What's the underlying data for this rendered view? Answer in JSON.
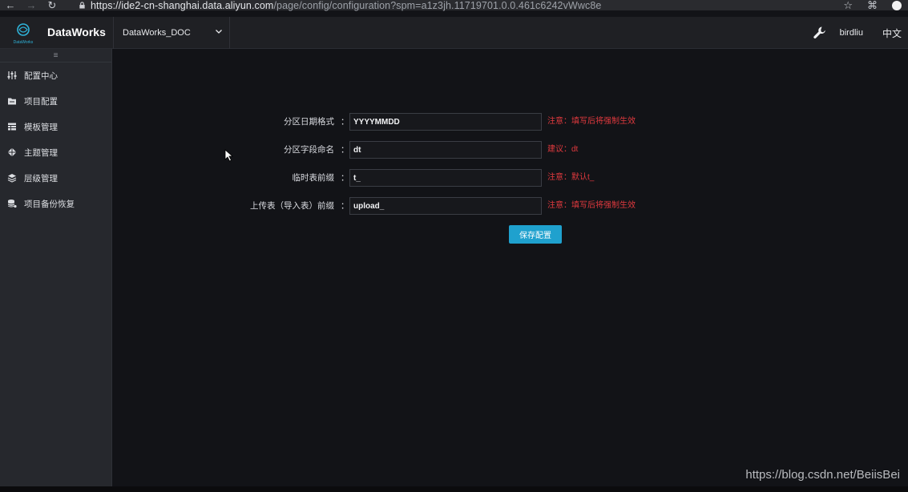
{
  "browser": {
    "url_host": "https://ide2-cn-shanghai.data.aliyun.com",
    "url_path": "/page/config/configuration?spm=a1z3jh.11719701.0.0.461c6242vWwc8e"
  },
  "header": {
    "brand": "DataWorks",
    "logo_text": "DataWorks",
    "project": "DataWorks_DOC",
    "username": "birdliu",
    "language": "中文"
  },
  "sidebar": {
    "collapse_glyph": "≡",
    "items": [
      {
        "label": "配置中心",
        "icon": "sliders-icon"
      },
      {
        "label": "项目配置",
        "icon": "folder-icon"
      },
      {
        "label": "模板管理",
        "icon": "table-icon"
      },
      {
        "label": "主题管理",
        "icon": "theme-icon"
      },
      {
        "label": "层级管理",
        "icon": "layers-icon"
      },
      {
        "label": "项目备份恢复",
        "icon": "database-icon"
      }
    ]
  },
  "form": {
    "rows": [
      {
        "label": "分区日期格式",
        "value": "YYYYMMDD",
        "hint": "注意：填写后将强制生效"
      },
      {
        "label": "分区字段命名",
        "value": "dt",
        "hint": "建议：dt"
      },
      {
        "label": "临时表前缀",
        "value": "t_",
        "hint": "注意：默认t_"
      },
      {
        "label": "上传表（导入表）前缀",
        "value": "upload_",
        "hint": "注意：填写后将强制生效"
      }
    ],
    "colon": "：",
    "save_label": "保存配置"
  },
  "watermark": "https://blog.csdn.net/BeiisBei",
  "colors": {
    "accent": "#1fa1ce",
    "hint": "#e0393e",
    "sidebar_bg": "#26282d",
    "main_bg": "#121317"
  }
}
